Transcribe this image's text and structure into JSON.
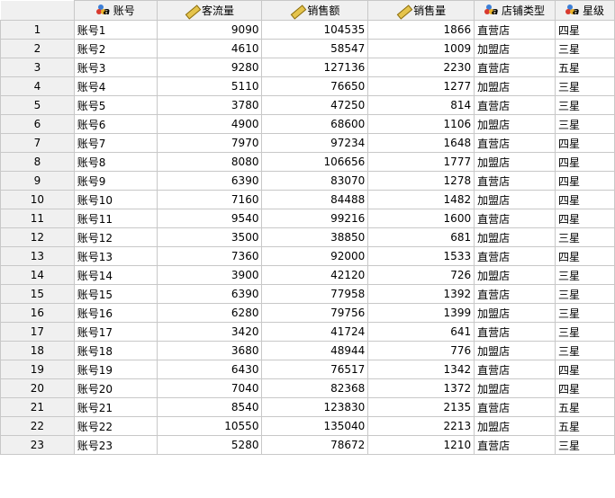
{
  "columns": [
    {
      "label": "账号",
      "icon": "nominal-string-icon"
    },
    {
      "label": "客流量",
      "icon": "scale-ruler-icon"
    },
    {
      "label": "销售额",
      "icon": "scale-ruler-icon"
    },
    {
      "label": "销售量",
      "icon": "scale-ruler-icon"
    },
    {
      "label": "店铺类型",
      "icon": "nominal-string-icon"
    },
    {
      "label": "星级",
      "icon": "nominal-string-icon"
    }
  ],
  "rows": [
    {
      "n": "1",
      "c": [
        "账号1",
        "9090",
        "104535",
        "1866",
        "直营店",
        "四星"
      ]
    },
    {
      "n": "2",
      "c": [
        "账号2",
        "4610",
        "58547",
        "1009",
        "加盟店",
        "三星"
      ]
    },
    {
      "n": "3",
      "c": [
        "账号3",
        "9280",
        "127136",
        "2230",
        "直营店",
        "五星"
      ]
    },
    {
      "n": "4",
      "c": [
        "账号4",
        "5110",
        "76650",
        "1277",
        "加盟店",
        "三星"
      ]
    },
    {
      "n": "5",
      "c": [
        "账号5",
        "3780",
        "47250",
        "814",
        "直营店",
        "三星"
      ]
    },
    {
      "n": "6",
      "c": [
        "账号6",
        "4900",
        "68600",
        "1106",
        "加盟店",
        "三星"
      ]
    },
    {
      "n": "7",
      "c": [
        "账号7",
        "7970",
        "97234",
        "1648",
        "直营店",
        "四星"
      ]
    },
    {
      "n": "8",
      "c": [
        "账号8",
        "8080",
        "106656",
        "1777",
        "加盟店",
        "四星"
      ]
    },
    {
      "n": "9",
      "c": [
        "账号9",
        "6390",
        "83070",
        "1278",
        "直营店",
        "四星"
      ]
    },
    {
      "n": "10",
      "c": [
        "账号10",
        "7160",
        "84488",
        "1482",
        "加盟店",
        "四星"
      ]
    },
    {
      "n": "11",
      "c": [
        "账号11",
        "9540",
        "99216",
        "1600",
        "直营店",
        "四星"
      ]
    },
    {
      "n": "12",
      "c": [
        "账号12",
        "3500",
        "38850",
        "681",
        "加盟店",
        "三星"
      ]
    },
    {
      "n": "13",
      "c": [
        "账号13",
        "7360",
        "92000",
        "1533",
        "直营店",
        "四星"
      ]
    },
    {
      "n": "14",
      "c": [
        "账号14",
        "3900",
        "42120",
        "726",
        "加盟店",
        "三星"
      ]
    },
    {
      "n": "15",
      "c": [
        "账号15",
        "6390",
        "77958",
        "1392",
        "直营店",
        "三星"
      ]
    },
    {
      "n": "16",
      "c": [
        "账号16",
        "6280",
        "79756",
        "1399",
        "加盟店",
        "三星"
      ]
    },
    {
      "n": "17",
      "c": [
        "账号17",
        "3420",
        "41724",
        "641",
        "直营店",
        "三星"
      ]
    },
    {
      "n": "18",
      "c": [
        "账号18",
        "3680",
        "48944",
        "776",
        "加盟店",
        "三星"
      ]
    },
    {
      "n": "19",
      "c": [
        "账号19",
        "6430",
        "76517",
        "1342",
        "直营店",
        "四星"
      ]
    },
    {
      "n": "20",
      "c": [
        "账号20",
        "7040",
        "82368",
        "1372",
        "加盟店",
        "四星"
      ]
    },
    {
      "n": "21",
      "c": [
        "账号21",
        "8540",
        "123830",
        "2135",
        "直营店",
        "五星"
      ]
    },
    {
      "n": "22",
      "c": [
        "账号22",
        "10550",
        "135040",
        "2213",
        "加盟店",
        "五星"
      ]
    },
    {
      "n": "23",
      "c": [
        "账号23",
        "5280",
        "78672",
        "1210",
        "直营店",
        "三星"
      ]
    }
  ]
}
